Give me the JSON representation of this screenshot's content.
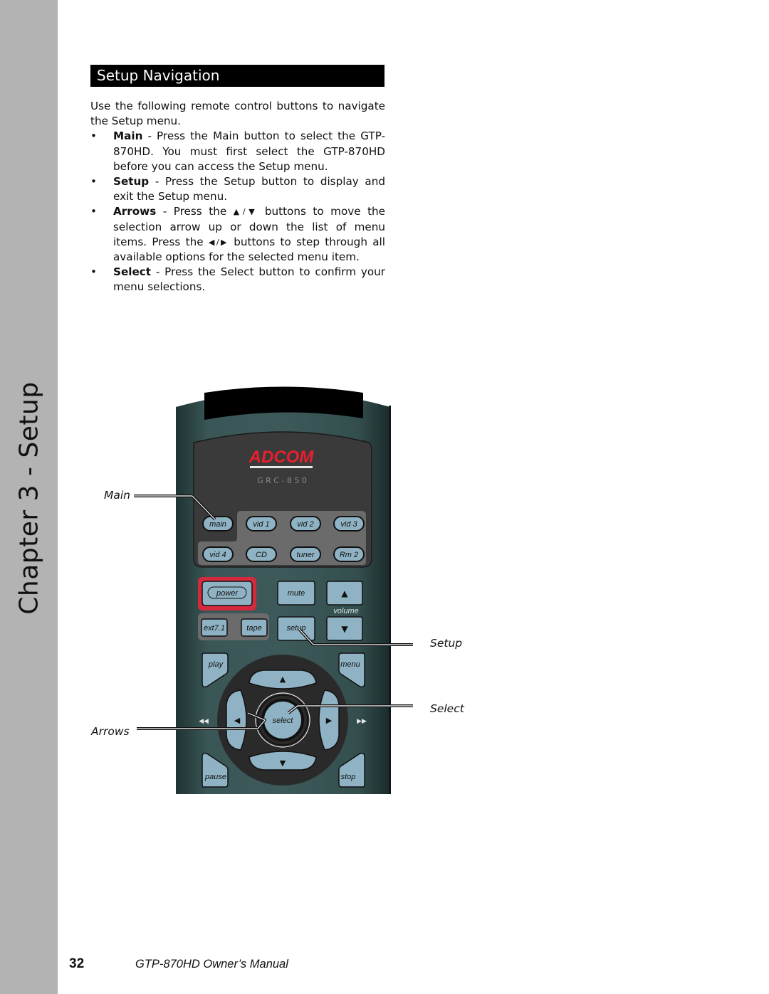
{
  "side_tab": {
    "title": "Chapter 3 - Setup"
  },
  "section": {
    "title": "Setup Navigation"
  },
  "intro": "Use the following remote control buttons to navigate the Setup menu.",
  "bullets": [
    {
      "term": "Main",
      "text": " - Press the Main button to select the GTP-870HD. You must first select the GTP-870HD before you can access the Setup menu."
    },
    {
      "term": "Setup",
      "text": " - Press the Setup button to display and exit the Setup menu."
    },
    {
      "term": "Arrows",
      "text_a": " - Press the ",
      "sym_ud": "▲/▼",
      "text_b": " buttons to move the selection arrow up or down the list of menu items. Press the ",
      "sym_lr": "◀/▶",
      "text_c": " buttons to step through all available options for the selected menu item."
    },
    {
      "term": "Select",
      "text": " - Press the Select button to confirm your menu selections."
    }
  ],
  "remote": {
    "brand": "ADCOM",
    "model": "G R C - 8 5 0",
    "colors": {
      "body": "#2f4a4a",
      "button": "#8fb3c4",
      "power_ring": "#d42a3c",
      "brand": "#e8202e"
    },
    "source_buttons": [
      "main",
      "vid 1",
      "vid 2",
      "vid 3",
      "vid 4",
      "CD",
      "tuner",
      "Rm 2"
    ],
    "power": "power",
    "mute": "mute",
    "volume": "volume",
    "vol_up": "▲",
    "vol_down": "▼",
    "ext": "ext7.1",
    "tape": "tape",
    "setup": "setup",
    "play": "play",
    "menu": "menu",
    "pause": "pause",
    "stop": "stop",
    "select": "select",
    "up": "▲",
    "down": "▼",
    "left": "◀",
    "right": "▶",
    "prev": "◀◀",
    "next": "▶▶"
  },
  "callouts": {
    "main": "Main",
    "setup": "Setup",
    "select": "Select",
    "arrows": "Arrows"
  },
  "footer": {
    "page": "32",
    "title": "GTP-870HD Owner’s Manual"
  }
}
